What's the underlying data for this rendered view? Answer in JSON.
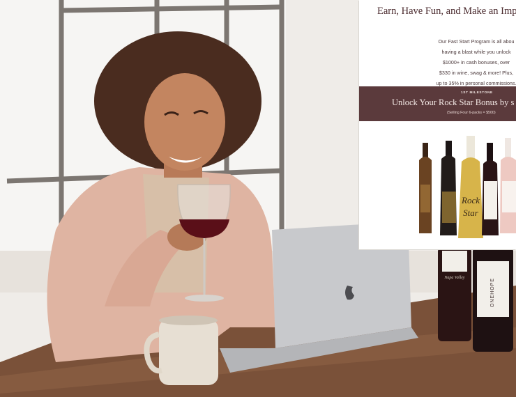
{
  "card": {
    "headline": "Earn, Have Fun, and Make an Impac",
    "intro_lines": [
      "Our Fast Start Program is all abou",
      "having a blast while you unlock",
      "$1000+ in cash bonuses, over",
      "$330 in wine, swag & more! Plus,",
      "up to 35% in personal commissions."
    ],
    "milestone": {
      "label": "1ST MILESTONE",
      "title": "Unlock Your Rock Star Bonus by s",
      "subtitle": "(Selling Four 6-packs = $500)"
    },
    "bottle_labels": {
      "rock_star": [
        "Rock",
        "Star"
      ]
    }
  },
  "scene": {
    "table_bottle_labels": {
      "onehope": "ONEHOPE",
      "napa_script": "Napa Valley"
    }
  },
  "colors": {
    "burgundy_band": "#5b3a3c",
    "blush_wall": "#f1ede8",
    "wood_table": "#7a5139",
    "laptop_silver": "#c8c9cc",
    "sweater_pink": "#dfb4a2"
  }
}
